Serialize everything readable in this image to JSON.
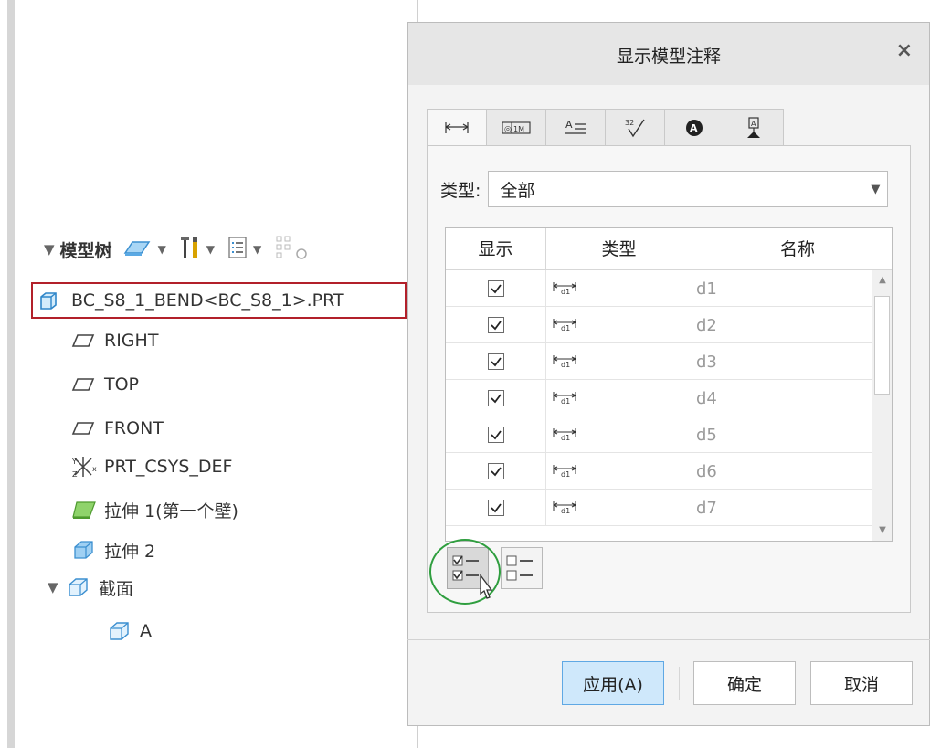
{
  "model_tree": {
    "title": "模型树",
    "items": [
      {
        "label": "BC_S8_1_BEND<BC_S8_1>.PRT",
        "icon": "part-icon",
        "selected": true
      },
      {
        "label": "RIGHT",
        "icon": "datum-plane-icon"
      },
      {
        "label": "TOP",
        "icon": "datum-plane-icon"
      },
      {
        "label": "FRONT",
        "icon": "datum-plane-icon"
      },
      {
        "label": "PRT_CSYS_DEF",
        "icon": "coordinate-system-icon"
      },
      {
        "label": "拉伸 1(第一个壁)",
        "icon": "sheetmetal-wall-icon"
      },
      {
        "label": "拉伸 2",
        "icon": "extrude-icon"
      },
      {
        "label": "截面",
        "icon": "section-folder-icon",
        "expanded": true
      },
      {
        "label": "A",
        "icon": "section-icon"
      }
    ]
  },
  "dialog": {
    "title": "显示模型注释",
    "close": "×",
    "tabs": [
      {
        "icon": "dimension-tab-icon",
        "active": true
      },
      {
        "icon": "gtol-tab-icon"
      },
      {
        "icon": "note-tab-icon"
      },
      {
        "icon": "surface-finish-tab-icon"
      },
      {
        "icon": "symbol-tab-icon"
      },
      {
        "icon": "datum-tab-icon"
      }
    ],
    "type_label": "类型:",
    "type_value": "全部",
    "columns": [
      "显示",
      "类型",
      "名称"
    ],
    "rows": [
      {
        "checked": true,
        "name": "d1"
      },
      {
        "checked": true,
        "name": "d2"
      },
      {
        "checked": true,
        "name": "d3"
      },
      {
        "checked": true,
        "name": "d4"
      },
      {
        "checked": true,
        "name": "d5"
      },
      {
        "checked": true,
        "name": "d6"
      },
      {
        "checked": true,
        "name": "d7"
      }
    ],
    "buttons": {
      "apply": "应用(A)",
      "ok": "确定",
      "cancel": "取消"
    }
  },
  "colors": {
    "selection_outline": "#b2202a",
    "highlight_ring": "#2f9e3f",
    "apply_button_bg": "#cfe8fb"
  }
}
